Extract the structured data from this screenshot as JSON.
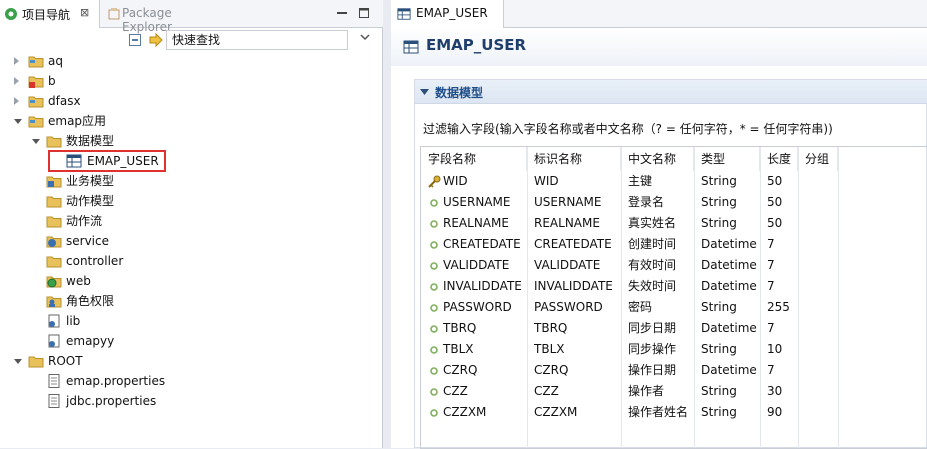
{
  "left_view": {
    "tabs": [
      {
        "label": "项目导航",
        "close": "⊠"
      },
      {
        "label": "Package Explorer"
      }
    ],
    "quick_find": "快速查找",
    "tree": [
      {
        "label": "aq",
        "expanded": false,
        "icon": "project-folder-icon"
      },
      {
        "label": "b",
        "expanded": false,
        "icon": "project-folder-error-icon"
      },
      {
        "label": "dfasx",
        "expanded": false,
        "icon": "project-folder-icon"
      },
      {
        "label": "emap应用",
        "expanded": true,
        "icon": "project-folder-icon"
      },
      {
        "label": "数据模型",
        "expanded": true,
        "icon": "data-model-folder-icon"
      },
      {
        "label": "EMAP_USER",
        "selected": true,
        "icon": "table-icon"
      },
      {
        "label": "业务模型",
        "icon": "business-model-icon"
      },
      {
        "label": "动作模型",
        "icon": "action-model-icon"
      },
      {
        "label": "动作流",
        "icon": "action-flow-icon"
      },
      {
        "label": "service",
        "icon": "service-icon"
      },
      {
        "label": "controller",
        "icon": "controller-folder-icon"
      },
      {
        "label": "web",
        "icon": "web-icon"
      },
      {
        "label": "角色权限",
        "icon": "role-permission-icon"
      },
      {
        "label": "lib",
        "icon": "lib-icon"
      },
      {
        "label": "emapyy",
        "icon": "emapyy-icon"
      },
      {
        "label": "ROOT",
        "expanded": true,
        "icon": "root-folder-icon"
      },
      {
        "label": "emap.properties",
        "icon": "properties-file-icon"
      },
      {
        "label": "jdbc.properties",
        "icon": "properties-file-icon"
      }
    ]
  },
  "editor": {
    "tab_label": "EMAP_USER",
    "title": "EMAP_USER",
    "section_title": "数据模型",
    "filter_label": "过滤输入字段(输入字段名称或者中文名称（? = 任何字符，* = 任何字符串))",
    "columns": [
      "字段名称",
      "标识名称",
      "中文名称",
      "类型",
      "长度",
      "分组"
    ],
    "rows": [
      {
        "field": "WID",
        "id": "WID",
        "cn": "主键",
        "type": "String",
        "len": "50",
        "group": "",
        "key": true
      },
      {
        "field": "USERNAME",
        "id": "USERNAME",
        "cn": "登录名",
        "type": "String",
        "len": "50",
        "group": ""
      },
      {
        "field": "REALNAME",
        "id": "REALNAME",
        "cn": "真实姓名",
        "type": "String",
        "len": "50",
        "group": ""
      },
      {
        "field": "CREATEDATE",
        "id": "CREATEDATE",
        "cn": "创建时间",
        "type": "Datetime",
        "len": "7",
        "group": ""
      },
      {
        "field": "VALIDDATE",
        "id": "VALIDDATE",
        "cn": "有效时间",
        "type": "Datetime",
        "len": "7",
        "group": ""
      },
      {
        "field": "INVALIDDATE",
        "id": "INVALIDDATE",
        "cn": "失效时间",
        "type": "Datetime",
        "len": "7",
        "group": ""
      },
      {
        "field": "PASSWORD",
        "id": "PASSWORD",
        "cn": "密码",
        "type": "String",
        "len": "255",
        "group": ""
      },
      {
        "field": "TBRQ",
        "id": "TBRQ",
        "cn": "同步日期",
        "type": "Datetime",
        "len": "7",
        "group": ""
      },
      {
        "field": "TBLX",
        "id": "TBLX",
        "cn": "同步操作",
        "type": "String",
        "len": "10",
        "group": ""
      },
      {
        "field": "CZRQ",
        "id": "CZRQ",
        "cn": "操作日期",
        "type": "Datetime",
        "len": "7",
        "group": ""
      },
      {
        "field": "CZZ",
        "id": "CZZ",
        "cn": "操作者",
        "type": "String",
        "len": "30",
        "group": ""
      },
      {
        "field": "CZZXM",
        "id": "CZZXM",
        "cn": "操作者姓名",
        "type": "String",
        "len": "90",
        "group": ""
      }
    ]
  },
  "colors": {
    "selection_border": "#e03131",
    "folder": "#e8c15a",
    "title": "#1f3e6b",
    "column_dot": "#7fb05a"
  }
}
